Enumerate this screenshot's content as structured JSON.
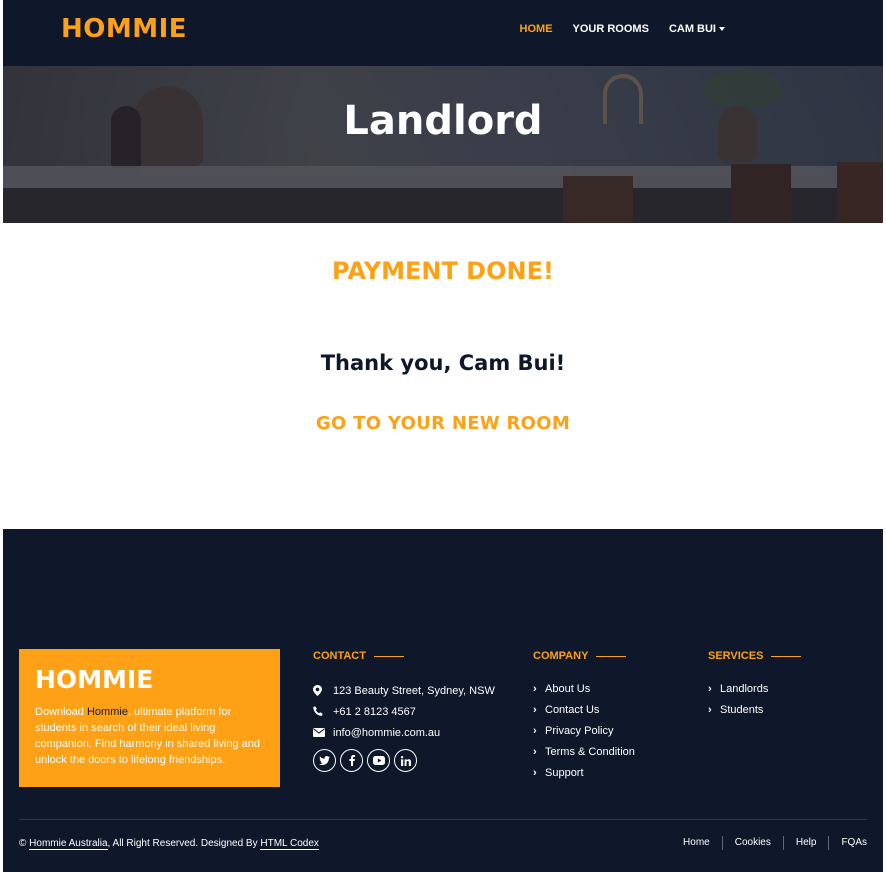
{
  "navbar": {
    "brand": "HOMMIE",
    "links": [
      {
        "label": "HOME",
        "active": true
      },
      {
        "label": "YOUR ROOMS",
        "active": false
      },
      {
        "label": "CAM BUI",
        "active": false,
        "dropdown": true
      }
    ]
  },
  "hero": {
    "title": "Landlord"
  },
  "main": {
    "status_title": "PAYMENT DONE!",
    "thanks": "Thank you, Cam Bui!",
    "cta": "GO TO YOUR NEW ROOM"
  },
  "footer": {
    "promo": {
      "title": "HOMMIE",
      "text_before": "Download ",
      "highlight": "Hommie",
      "text_after": ", ultimate platform for students in search of their ideal living companion. Find harmony in shared living and unlock the doors to lifelong friendships."
    },
    "contact": {
      "title": "CONTACT",
      "address": "123 Beauty Street, Sydney, NSW",
      "phone": "+61 2 8123 4567",
      "email": "info@hommie.com.au",
      "social": [
        "twitter-icon",
        "facebook-icon",
        "youtube-icon",
        "linkedin-icon"
      ]
    },
    "company": {
      "title": "COMPANY",
      "items": [
        "About Us",
        "Contact Us",
        "Privacy Policy",
        "Terms & Condition",
        "Support"
      ]
    },
    "services": {
      "title": "SERVICES",
      "items": [
        "Landlords",
        "Students"
      ]
    },
    "copyright": {
      "prefix": "© ",
      "owner": "Hommie Australia",
      "middle": ", All Right Reserved. Designed By ",
      "designer": "HTML Codex"
    },
    "bottom_links": [
      "Home",
      "Cookies",
      "Help",
      "FQAs"
    ]
  },
  "colors": {
    "accent": "#fea116",
    "dark": "#0f172b",
    "white": "#ffffff"
  }
}
